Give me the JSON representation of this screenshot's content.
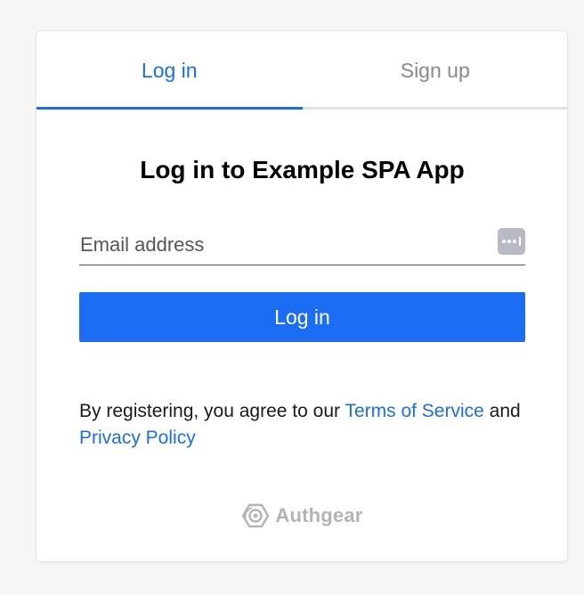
{
  "tabs": [
    {
      "label": "Log in",
      "active": true
    },
    {
      "label": "Sign up",
      "active": false
    }
  ],
  "title": "Log in to Example SPA App",
  "email": {
    "placeholder": "Email address",
    "value": ""
  },
  "login_button": "Log in",
  "terms": {
    "prefix": "By registering, you agree to our ",
    "terms_link": "Terms of Service",
    "middle": " and",
    "privacy_link": "Privacy Policy"
  },
  "brand": {
    "name": "Authgear",
    "icon": "authgear-logo-icon"
  },
  "colors": {
    "accent": "#1b6ee8",
    "button": "#1b6ef3",
    "inactive_tab": "#888888",
    "brand_gray": "#b4b4b4"
  }
}
